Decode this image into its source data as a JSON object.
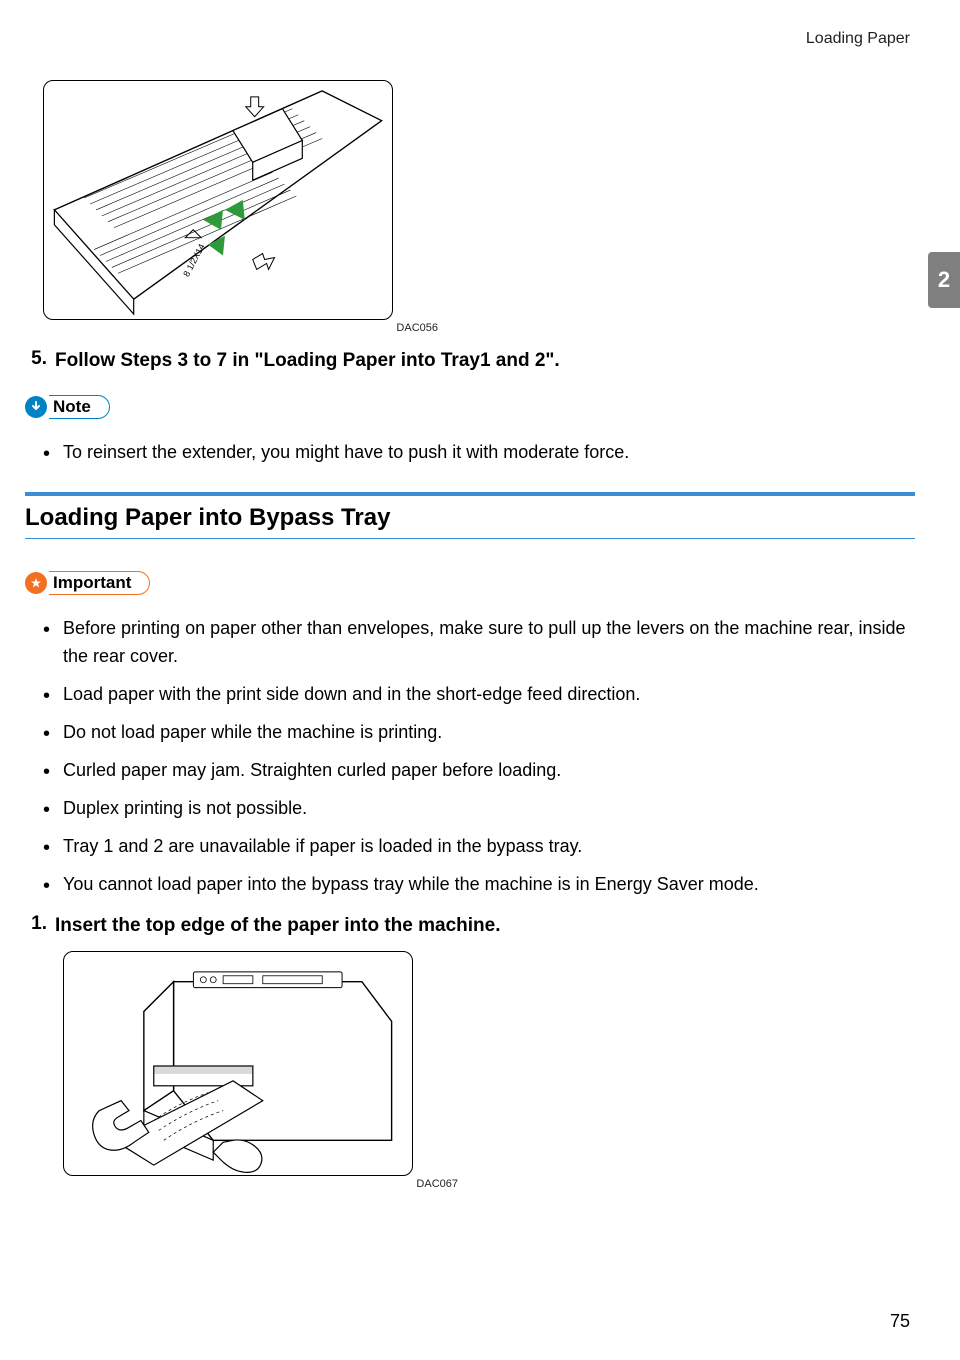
{
  "header": {
    "running_title": "Loading Paper"
  },
  "chapter_tab": "2",
  "figure1": {
    "caption": "DAC056",
    "alt": "Printer tray with paper guides, arrows indicating adjustment, marking 8 1/2 x 14"
  },
  "step5": {
    "num": "5.",
    "text": "Follow Steps 3 to 7 in \"Loading Paper into Tray1 and 2\"."
  },
  "note": {
    "label": "Note",
    "items": [
      "To reinsert the extender, you might have to push it with moderate force."
    ]
  },
  "section": {
    "title": "Loading Paper into Bypass Tray"
  },
  "important": {
    "label": "Important",
    "items": [
      "Before printing on paper other than envelopes, make sure to pull up the levers on the machine rear, inside the rear cover.",
      "Load paper with the print side down and in the short-edge feed direction.",
      "Do not load paper while the machine is printing.",
      "Curled paper may jam. Straighten curled paper before loading.",
      "Duplex printing is not possible.",
      "Tray 1 and 2 are unavailable if paper is loaded in the bypass tray.",
      "You cannot load paper into the bypass tray while the machine is in Energy Saver mode."
    ]
  },
  "bypass_step1": {
    "num": "1.",
    "text": "Insert the top edge of the paper into the machine."
  },
  "figure2": {
    "caption": "DAC067",
    "alt": "Hands inserting paper into printer bypass tray"
  },
  "footer": {
    "page": "75"
  }
}
